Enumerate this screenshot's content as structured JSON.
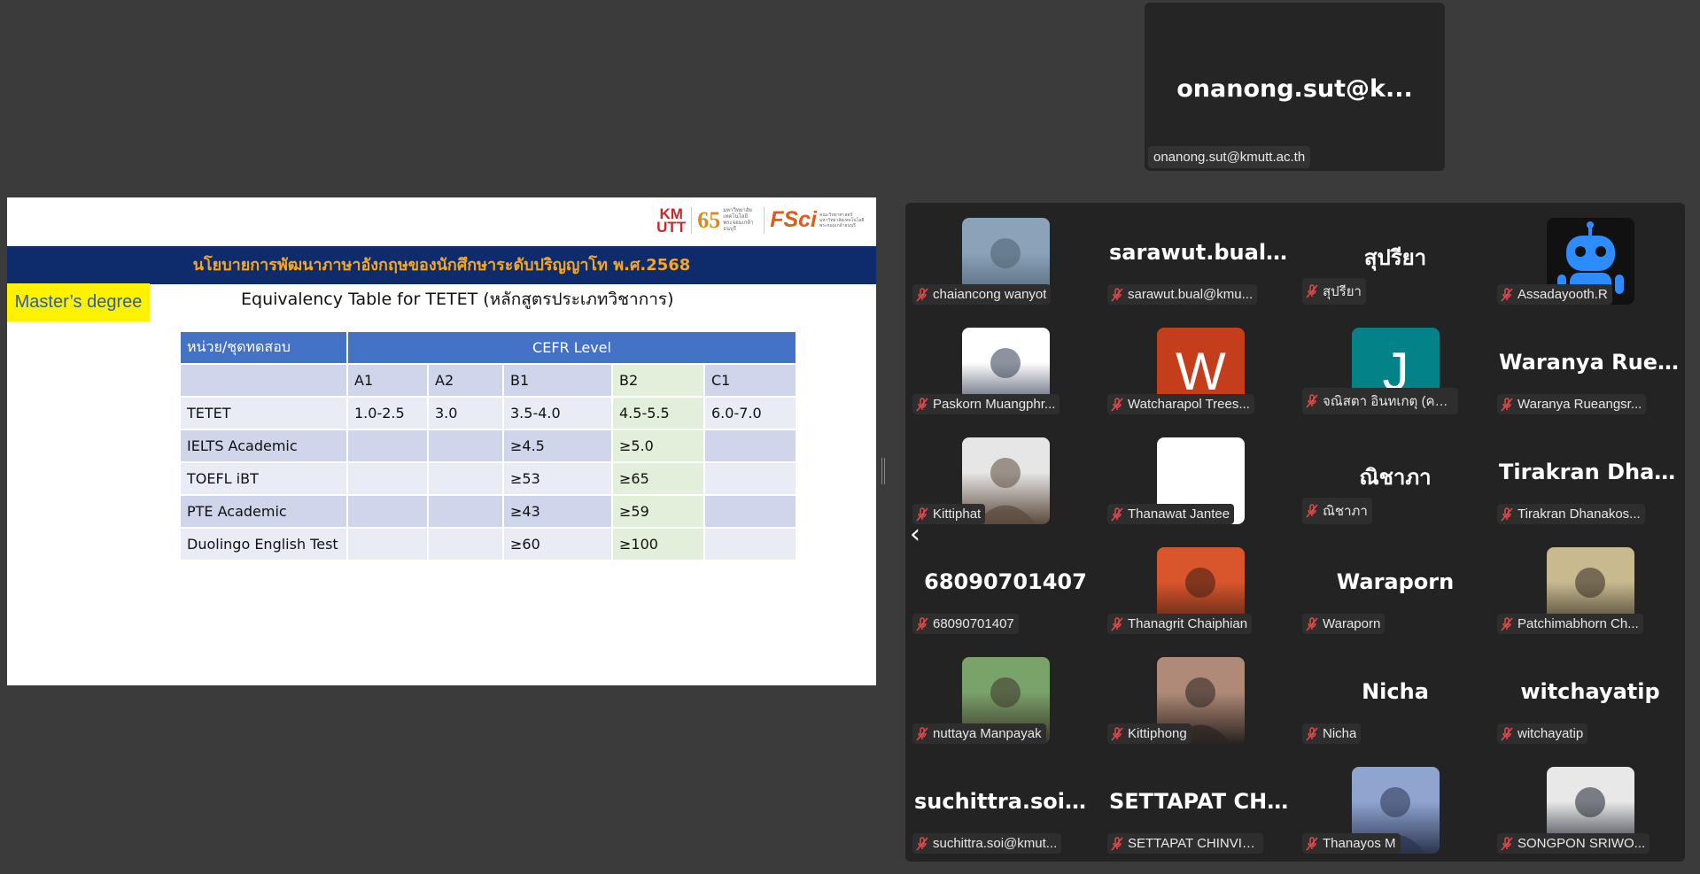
{
  "speaker": {
    "display_name": "onanong.sut@k...",
    "label": "onanong.sut@kmutt.ac.th"
  },
  "slide": {
    "logos": {
      "km": "KM\nUTT",
      "sixty_five": "65",
      "fsci": "FSci"
    },
    "banner": "นโยบายการพัฒนาภาษาอังกฤษของนักศึกษาระดับปริญญาโท พ.ศ.2568",
    "badge": "Master’s degree",
    "subtitle": "Equivalency Table for TETET (หลักสูตรประเภทวิชาการ)",
    "table": {
      "header_col": "หน่วย/ชุดทดสอบ",
      "header_group": "CEFR Level",
      "levels": [
        "A1",
        "A2",
        "B1",
        "B2",
        "C1"
      ],
      "rows": [
        {
          "name": "TETET",
          "cells": [
            "1.0-2.5",
            "3.0",
            "3.5-4.0",
            "4.5-5.5",
            "6.0-7.0"
          ]
        },
        {
          "name": "IELTS Academic",
          "cells": [
            "",
            "",
            "≥4.5",
            "≥5.0",
            ""
          ]
        },
        {
          "name": "TOEFL iBT",
          "cells": [
            "",
            "",
            "≥53",
            "≥65",
            ""
          ]
        },
        {
          "name": "PTE Academic",
          "cells": [
            "",
            "",
            "≥43",
            "≥59",
            ""
          ]
        },
        {
          "name": "Duolingo English Test",
          "cells": [
            "",
            "",
            "≥60",
            "≥100",
            ""
          ]
        }
      ]
    }
  },
  "gallery": {
    "participants": [
      {
        "label": "chaiancong wanyot",
        "display": "",
        "avatar": "photo",
        "colors": [
          "#8aa3b8",
          "#4d5f6f"
        ]
      },
      {
        "label": "sarawut.bual@kmu...",
        "display": "sarawut.bual@k...",
        "avatar": "none"
      },
      {
        "label": "สุปรียา",
        "display": "สุปรียา",
        "avatar": "none"
      },
      {
        "label": "Assadayooth.R",
        "display": "",
        "avatar": "robot"
      },
      {
        "label": "Paskorn Muangphr...",
        "display": "",
        "avatar": "photo",
        "colors": [
          "#ffffff",
          "#2f3a4f"
        ]
      },
      {
        "label": "Watcharapol Trees...",
        "display": "",
        "avatar": "initial",
        "initial": "W",
        "bg": "#c43e1c"
      },
      {
        "label": "จณิสตา อินทเกตุ (คณิ...",
        "display": "",
        "avatar": "initial",
        "initial": "J",
        "bg": "#038387"
      },
      {
        "label": "Waranya Rueangsr...",
        "display": "Waranya Ruean...",
        "avatar": "none"
      },
      {
        "label": "Kittiphat",
        "display": "",
        "avatar": "photo",
        "colors": [
          "#e6e6e6",
          "#5b4a3d"
        ]
      },
      {
        "label": "Thanawat Jantee",
        "display": "",
        "avatar": "blank"
      },
      {
        "label": "ณิชาภา",
        "display": "ณิชาภา",
        "avatar": "none"
      },
      {
        "label": "Tirakran Dhanakos...",
        "display": "Tirakran Dhana...",
        "avatar": "none"
      },
      {
        "label": "68090701407",
        "display": "68090701407",
        "avatar": "none"
      },
      {
        "label": "Thanagrit Chaiphian",
        "display": "",
        "avatar": "photo",
        "colors": [
          "#d9552b",
          "#3a1d14"
        ]
      },
      {
        "label": "Waraporn",
        "display": "Waraporn",
        "avatar": "none"
      },
      {
        "label": "Patchimabhorn Ch...",
        "display": "",
        "avatar": "photo",
        "colors": [
          "#c9b98f",
          "#2f2a22"
        ]
      },
      {
        "label": "nuttaya Manpayak",
        "display": "",
        "avatar": "photo",
        "colors": [
          "#7aa36a",
          "#3c3328"
        ]
      },
      {
        "label": "Kittiphong",
        "display": "",
        "avatar": "photo",
        "colors": [
          "#b08a78",
          "#2a2320"
        ]
      },
      {
        "label": "Nicha",
        "display": "Nicha",
        "avatar": "none"
      },
      {
        "label": "witchayatip",
        "display": "witchayatip",
        "avatar": "none"
      },
      {
        "label": "suchittra.soi@kmut...",
        "display": "suchittra.soi@k...",
        "avatar": "none"
      },
      {
        "label": "SETTAPAT CHINVIR...",
        "display": "SETTAPAT CHIN...",
        "avatar": "none"
      },
      {
        "label": "Thanayos M",
        "display": "",
        "avatar": "photo",
        "colors": [
          "#8fa4cf",
          "#2b3550"
        ]
      },
      {
        "label": "SONGPON SRIWO...",
        "display": "",
        "avatar": "photo",
        "colors": [
          "#e8e8e8",
          "#1e2430"
        ]
      }
    ]
  }
}
